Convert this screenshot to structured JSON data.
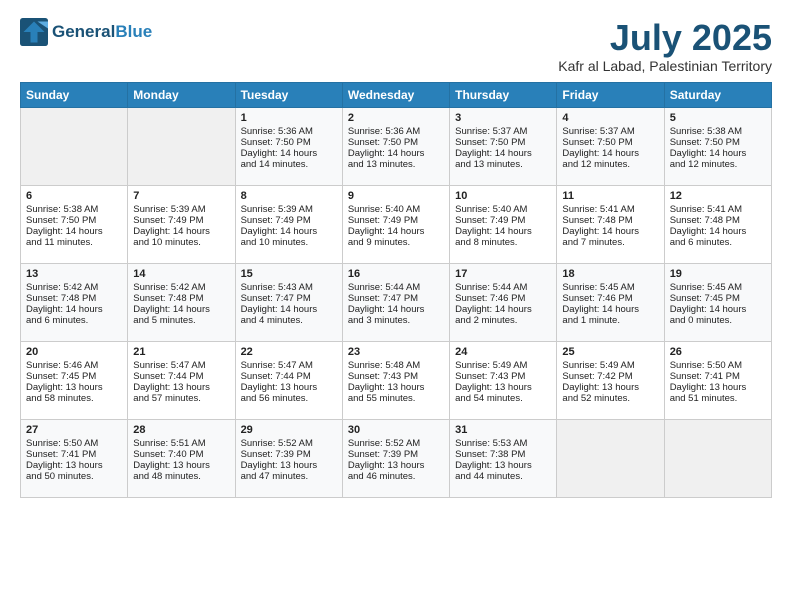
{
  "header": {
    "logo_line1": "General",
    "logo_line2": "Blue",
    "title": "July 2025",
    "location": "Kafr al Labad, Palestinian Territory"
  },
  "weekdays": [
    "Sunday",
    "Monday",
    "Tuesday",
    "Wednesday",
    "Thursday",
    "Friday",
    "Saturday"
  ],
  "weeks": [
    [
      {
        "day": "",
        "info": ""
      },
      {
        "day": "",
        "info": ""
      },
      {
        "day": "1",
        "info": "Sunrise: 5:36 AM\nSunset: 7:50 PM\nDaylight: 14 hours\nand 14 minutes."
      },
      {
        "day": "2",
        "info": "Sunrise: 5:36 AM\nSunset: 7:50 PM\nDaylight: 14 hours\nand 13 minutes."
      },
      {
        "day": "3",
        "info": "Sunrise: 5:37 AM\nSunset: 7:50 PM\nDaylight: 14 hours\nand 13 minutes."
      },
      {
        "day": "4",
        "info": "Sunrise: 5:37 AM\nSunset: 7:50 PM\nDaylight: 14 hours\nand 12 minutes."
      },
      {
        "day": "5",
        "info": "Sunrise: 5:38 AM\nSunset: 7:50 PM\nDaylight: 14 hours\nand 12 minutes."
      }
    ],
    [
      {
        "day": "6",
        "info": "Sunrise: 5:38 AM\nSunset: 7:50 PM\nDaylight: 14 hours\nand 11 minutes."
      },
      {
        "day": "7",
        "info": "Sunrise: 5:39 AM\nSunset: 7:49 PM\nDaylight: 14 hours\nand 10 minutes."
      },
      {
        "day": "8",
        "info": "Sunrise: 5:39 AM\nSunset: 7:49 PM\nDaylight: 14 hours\nand 10 minutes."
      },
      {
        "day": "9",
        "info": "Sunrise: 5:40 AM\nSunset: 7:49 PM\nDaylight: 14 hours\nand 9 minutes."
      },
      {
        "day": "10",
        "info": "Sunrise: 5:40 AM\nSunset: 7:49 PM\nDaylight: 14 hours\nand 8 minutes."
      },
      {
        "day": "11",
        "info": "Sunrise: 5:41 AM\nSunset: 7:48 PM\nDaylight: 14 hours\nand 7 minutes."
      },
      {
        "day": "12",
        "info": "Sunrise: 5:41 AM\nSunset: 7:48 PM\nDaylight: 14 hours\nand 6 minutes."
      }
    ],
    [
      {
        "day": "13",
        "info": "Sunrise: 5:42 AM\nSunset: 7:48 PM\nDaylight: 14 hours\nand 6 minutes."
      },
      {
        "day": "14",
        "info": "Sunrise: 5:42 AM\nSunset: 7:48 PM\nDaylight: 14 hours\nand 5 minutes."
      },
      {
        "day": "15",
        "info": "Sunrise: 5:43 AM\nSunset: 7:47 PM\nDaylight: 14 hours\nand 4 minutes."
      },
      {
        "day": "16",
        "info": "Sunrise: 5:44 AM\nSunset: 7:47 PM\nDaylight: 14 hours\nand 3 minutes."
      },
      {
        "day": "17",
        "info": "Sunrise: 5:44 AM\nSunset: 7:46 PM\nDaylight: 14 hours\nand 2 minutes."
      },
      {
        "day": "18",
        "info": "Sunrise: 5:45 AM\nSunset: 7:46 PM\nDaylight: 14 hours\nand 1 minute."
      },
      {
        "day": "19",
        "info": "Sunrise: 5:45 AM\nSunset: 7:45 PM\nDaylight: 14 hours\nand 0 minutes."
      }
    ],
    [
      {
        "day": "20",
        "info": "Sunrise: 5:46 AM\nSunset: 7:45 PM\nDaylight: 13 hours\nand 58 minutes."
      },
      {
        "day": "21",
        "info": "Sunrise: 5:47 AM\nSunset: 7:44 PM\nDaylight: 13 hours\nand 57 minutes."
      },
      {
        "day": "22",
        "info": "Sunrise: 5:47 AM\nSunset: 7:44 PM\nDaylight: 13 hours\nand 56 minutes."
      },
      {
        "day": "23",
        "info": "Sunrise: 5:48 AM\nSunset: 7:43 PM\nDaylight: 13 hours\nand 55 minutes."
      },
      {
        "day": "24",
        "info": "Sunrise: 5:49 AM\nSunset: 7:43 PM\nDaylight: 13 hours\nand 54 minutes."
      },
      {
        "day": "25",
        "info": "Sunrise: 5:49 AM\nSunset: 7:42 PM\nDaylight: 13 hours\nand 52 minutes."
      },
      {
        "day": "26",
        "info": "Sunrise: 5:50 AM\nSunset: 7:41 PM\nDaylight: 13 hours\nand 51 minutes."
      }
    ],
    [
      {
        "day": "27",
        "info": "Sunrise: 5:50 AM\nSunset: 7:41 PM\nDaylight: 13 hours\nand 50 minutes."
      },
      {
        "day": "28",
        "info": "Sunrise: 5:51 AM\nSunset: 7:40 PM\nDaylight: 13 hours\nand 48 minutes."
      },
      {
        "day": "29",
        "info": "Sunrise: 5:52 AM\nSunset: 7:39 PM\nDaylight: 13 hours\nand 47 minutes."
      },
      {
        "day": "30",
        "info": "Sunrise: 5:52 AM\nSunset: 7:39 PM\nDaylight: 13 hours\nand 46 minutes."
      },
      {
        "day": "31",
        "info": "Sunrise: 5:53 AM\nSunset: 7:38 PM\nDaylight: 13 hours\nand 44 minutes."
      },
      {
        "day": "",
        "info": ""
      },
      {
        "day": "",
        "info": ""
      }
    ]
  ]
}
